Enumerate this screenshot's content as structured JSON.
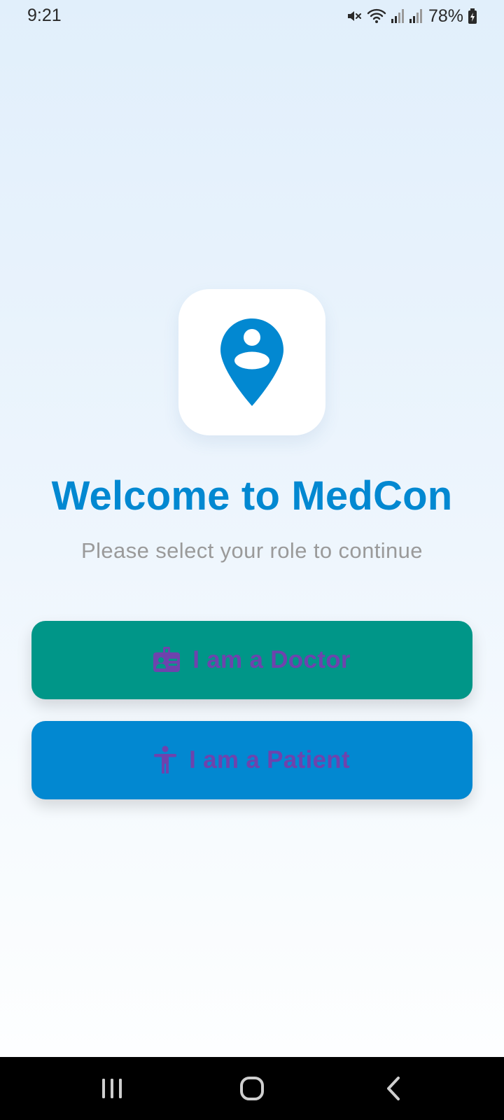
{
  "status_bar": {
    "time": "9:21",
    "battery_percent": "78%",
    "icons": [
      "mute-icon",
      "wifi-icon",
      "signal-icon",
      "signal-icon",
      "battery-charging-icon"
    ]
  },
  "logo": {
    "icon": "location-person-pin-icon",
    "color": "#0288d1"
  },
  "welcome": {
    "title": "Welcome to MedCon",
    "subtitle": "Please select your role to continue"
  },
  "roles": {
    "doctor": {
      "label": "I am a Doctor",
      "icon": "badge-icon",
      "color": "#009688"
    },
    "patient": {
      "label": "I am a Patient",
      "icon": "accessibility-icon",
      "color": "#0288d1"
    }
  },
  "colors": {
    "accent": "#0288d1",
    "label_text": "#6e43ad"
  },
  "nav_bar": {
    "buttons": [
      "recent-apps-icon",
      "home-icon",
      "back-icon"
    ]
  }
}
